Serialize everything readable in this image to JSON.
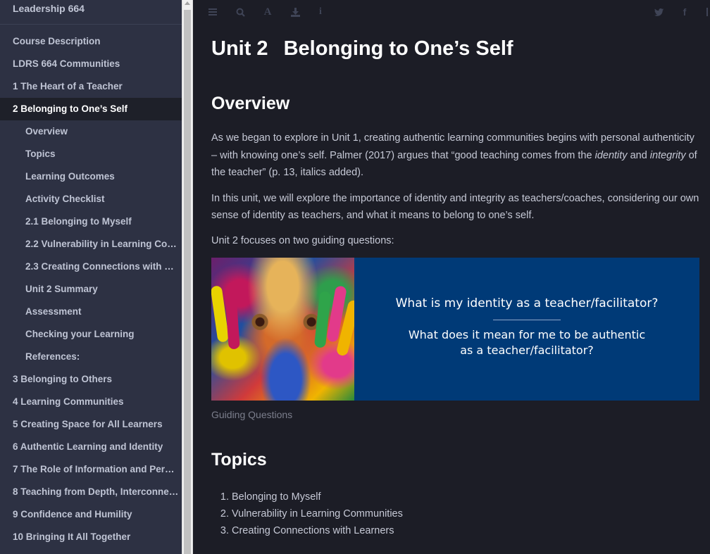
{
  "sidebar": {
    "title": "Leadership 664",
    "items": [
      {
        "label": "Course Description",
        "level": 0,
        "active": false
      },
      {
        "label": "LDRS 664 Communities",
        "level": 0,
        "active": false
      },
      {
        "label": "1 The Heart of a Teacher",
        "level": 0,
        "active": false
      },
      {
        "label": "2 Belonging to One’s Self",
        "level": 0,
        "active": true
      },
      {
        "label": "Overview",
        "level": 1,
        "active": false
      },
      {
        "label": "Topics",
        "level": 1,
        "active": false
      },
      {
        "label": "Learning Outcomes",
        "level": 1,
        "active": false
      },
      {
        "label": "Activity Checklist",
        "level": 1,
        "active": false
      },
      {
        "label": "2.1 Belonging to Myself",
        "level": 1,
        "active": false
      },
      {
        "label": "2.2 Vulnerability in Learning Co…",
        "level": 1,
        "active": false
      },
      {
        "label": "2.3 Creating Connections with …",
        "level": 1,
        "active": false
      },
      {
        "label": "Unit 2 Summary",
        "level": 1,
        "active": false
      },
      {
        "label": "Assessment",
        "level": 1,
        "active": false
      },
      {
        "label": "Checking your Learning",
        "level": 1,
        "active": false
      },
      {
        "label": "References:",
        "level": 1,
        "active": false
      },
      {
        "label": "3 Belonging to Others",
        "level": 0,
        "active": false
      },
      {
        "label": "4 Learning Communities",
        "level": 0,
        "active": false
      },
      {
        "label": "5 Creating Space for All Learners",
        "level": 0,
        "active": false
      },
      {
        "label": "6 Authentic Learning and Identity",
        "level": 0,
        "active": false
      },
      {
        "label": "7 The Role of Information and Per…",
        "level": 0,
        "active": false
      },
      {
        "label": "8 Teaching from Depth, Interconne…",
        "level": 0,
        "active": false
      },
      {
        "label": "9 Confidence and Humility",
        "level": 0,
        "active": false
      },
      {
        "label": "10 Bringing It All Together",
        "level": 0,
        "active": false
      }
    ]
  },
  "toolbar": {
    "icons": [
      "menu-icon",
      "search-icon",
      "font-icon",
      "download-icon",
      "info-icon",
      "twitter-icon",
      "facebook-icon"
    ],
    "font_glyph": "A",
    "info_glyph": "i",
    "facebook_glyph": "f"
  },
  "page": {
    "unit_number": "Unit 2",
    "unit_title": "Belonging to One’s Self",
    "overview_heading": "Overview",
    "p1": {
      "a": "As we began to explore in Unit 1, creating authentic learning communities begins with personal authenticity – with knowing one’s self. Palmer (2017) argues that “good teaching comes from the ",
      "em1": "identity",
      "b": " and ",
      "em2": "integrity",
      "c": " of the teacher” (p. 13, italics added)."
    },
    "p2": "In this unit, we will explore the importance of identity and integrity as teachers/coaches, considering our own sense of identity as teachers, and what it means to belong to one’s self.",
    "p3": "Unit 2 focuses on two guiding questions:",
    "figure": {
      "question1": "What is my identity as a teacher/facilitator?",
      "question2_line1": "What does it mean for me to be authentic",
      "question2_line2": "as a teacher/facilitator?",
      "caption": "Guiding Questions",
      "banner_color": "#003a77"
    },
    "topics_heading": "Topics",
    "topics": [
      "Belonging to Myself",
      "Vulnerability in Learning Communities",
      "Creating Connections with Learners"
    ]
  }
}
